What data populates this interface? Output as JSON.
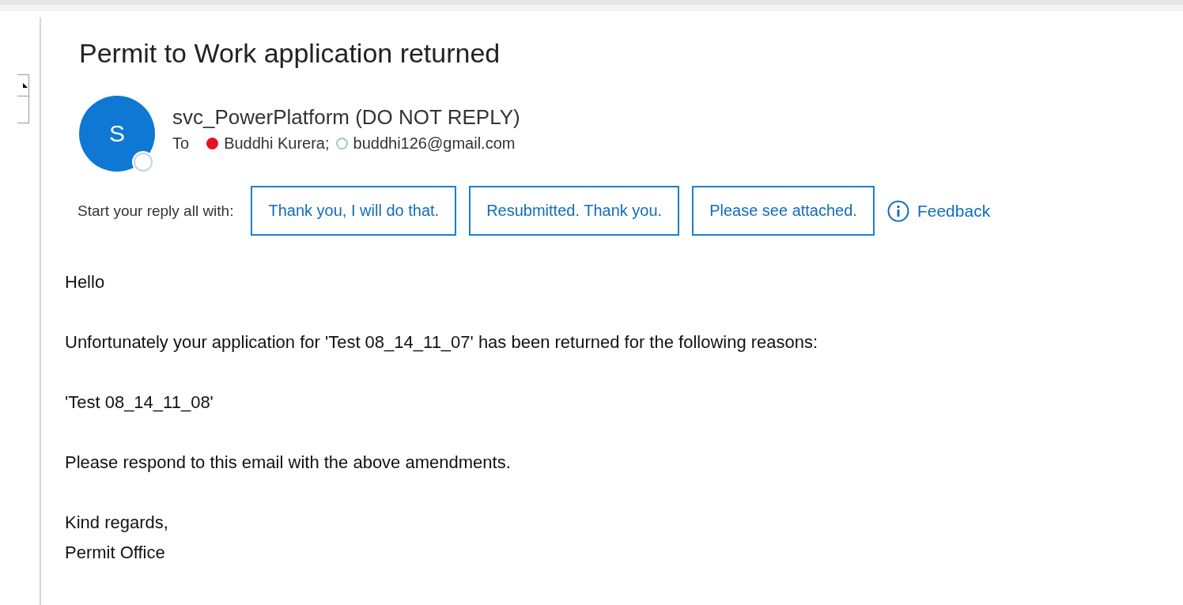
{
  "message": {
    "subject": "Permit to Work application returned",
    "sender": {
      "initial": "S",
      "name": "svc_PowerPlatform (DO NOT REPLY)"
    },
    "to_label": "To",
    "recipients": [
      {
        "name": "Buddhi Kurera;",
        "color": "#e81123",
        "filled": true
      },
      {
        "name": "buddhi126@gmail.com",
        "color": "#a9c1cf",
        "filled": false
      }
    ],
    "suggested_replies": {
      "label": "Start your reply all with:",
      "options": [
        "Thank you, I will do that.",
        "Resubmitted. Thank you.",
        "Please see attached."
      ],
      "feedback": "Feedback"
    },
    "body": [
      [
        "Hello"
      ],
      [
        "Unfortunately your application for 'Test 08_14_11_07' has been returned for the following reasons:"
      ],
      [
        "'Test 08_14_11_08'"
      ],
      [
        "Please respond to this email with the above amendments."
      ],
      [
        "Kind regards,",
        "Permit Office"
      ]
    ]
  }
}
